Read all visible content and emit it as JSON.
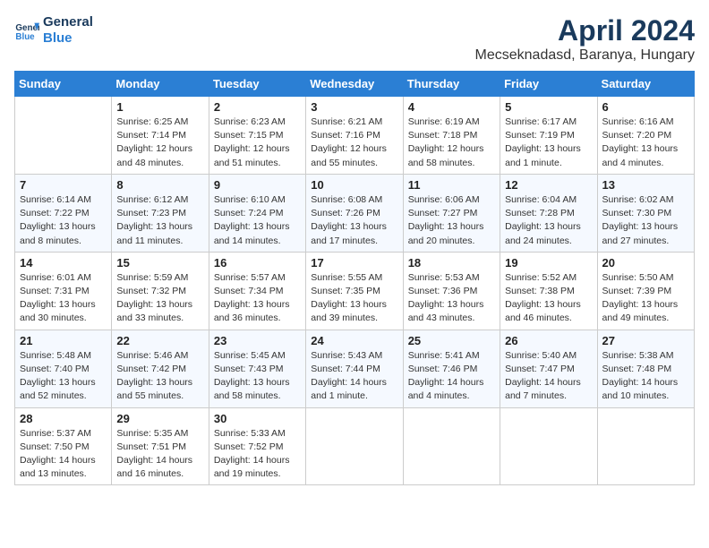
{
  "header": {
    "logo_line1": "General",
    "logo_line2": "Blue",
    "month": "April 2024",
    "location": "Mecseknadasd, Baranya, Hungary"
  },
  "days_of_week": [
    "Sunday",
    "Monday",
    "Tuesday",
    "Wednesday",
    "Thursday",
    "Friday",
    "Saturday"
  ],
  "weeks": [
    [
      {
        "day": "",
        "info": ""
      },
      {
        "day": "1",
        "info": "Sunrise: 6:25 AM\nSunset: 7:14 PM\nDaylight: 12 hours\nand 48 minutes."
      },
      {
        "day": "2",
        "info": "Sunrise: 6:23 AM\nSunset: 7:15 PM\nDaylight: 12 hours\nand 51 minutes."
      },
      {
        "day": "3",
        "info": "Sunrise: 6:21 AM\nSunset: 7:16 PM\nDaylight: 12 hours\nand 55 minutes."
      },
      {
        "day": "4",
        "info": "Sunrise: 6:19 AM\nSunset: 7:18 PM\nDaylight: 12 hours\nand 58 minutes."
      },
      {
        "day": "5",
        "info": "Sunrise: 6:17 AM\nSunset: 7:19 PM\nDaylight: 13 hours\nand 1 minute."
      },
      {
        "day": "6",
        "info": "Sunrise: 6:16 AM\nSunset: 7:20 PM\nDaylight: 13 hours\nand 4 minutes."
      }
    ],
    [
      {
        "day": "7",
        "info": "Sunrise: 6:14 AM\nSunset: 7:22 PM\nDaylight: 13 hours\nand 8 minutes."
      },
      {
        "day": "8",
        "info": "Sunrise: 6:12 AM\nSunset: 7:23 PM\nDaylight: 13 hours\nand 11 minutes."
      },
      {
        "day": "9",
        "info": "Sunrise: 6:10 AM\nSunset: 7:24 PM\nDaylight: 13 hours\nand 14 minutes."
      },
      {
        "day": "10",
        "info": "Sunrise: 6:08 AM\nSunset: 7:26 PM\nDaylight: 13 hours\nand 17 minutes."
      },
      {
        "day": "11",
        "info": "Sunrise: 6:06 AM\nSunset: 7:27 PM\nDaylight: 13 hours\nand 20 minutes."
      },
      {
        "day": "12",
        "info": "Sunrise: 6:04 AM\nSunset: 7:28 PM\nDaylight: 13 hours\nand 24 minutes."
      },
      {
        "day": "13",
        "info": "Sunrise: 6:02 AM\nSunset: 7:30 PM\nDaylight: 13 hours\nand 27 minutes."
      }
    ],
    [
      {
        "day": "14",
        "info": "Sunrise: 6:01 AM\nSunset: 7:31 PM\nDaylight: 13 hours\nand 30 minutes."
      },
      {
        "day": "15",
        "info": "Sunrise: 5:59 AM\nSunset: 7:32 PM\nDaylight: 13 hours\nand 33 minutes."
      },
      {
        "day": "16",
        "info": "Sunrise: 5:57 AM\nSunset: 7:34 PM\nDaylight: 13 hours\nand 36 minutes."
      },
      {
        "day": "17",
        "info": "Sunrise: 5:55 AM\nSunset: 7:35 PM\nDaylight: 13 hours\nand 39 minutes."
      },
      {
        "day": "18",
        "info": "Sunrise: 5:53 AM\nSunset: 7:36 PM\nDaylight: 13 hours\nand 43 minutes."
      },
      {
        "day": "19",
        "info": "Sunrise: 5:52 AM\nSunset: 7:38 PM\nDaylight: 13 hours\nand 46 minutes."
      },
      {
        "day": "20",
        "info": "Sunrise: 5:50 AM\nSunset: 7:39 PM\nDaylight: 13 hours\nand 49 minutes."
      }
    ],
    [
      {
        "day": "21",
        "info": "Sunrise: 5:48 AM\nSunset: 7:40 PM\nDaylight: 13 hours\nand 52 minutes."
      },
      {
        "day": "22",
        "info": "Sunrise: 5:46 AM\nSunset: 7:42 PM\nDaylight: 13 hours\nand 55 minutes."
      },
      {
        "day": "23",
        "info": "Sunrise: 5:45 AM\nSunset: 7:43 PM\nDaylight: 13 hours\nand 58 minutes."
      },
      {
        "day": "24",
        "info": "Sunrise: 5:43 AM\nSunset: 7:44 PM\nDaylight: 14 hours\nand 1 minute."
      },
      {
        "day": "25",
        "info": "Sunrise: 5:41 AM\nSunset: 7:46 PM\nDaylight: 14 hours\nand 4 minutes."
      },
      {
        "day": "26",
        "info": "Sunrise: 5:40 AM\nSunset: 7:47 PM\nDaylight: 14 hours\nand 7 minutes."
      },
      {
        "day": "27",
        "info": "Sunrise: 5:38 AM\nSunset: 7:48 PM\nDaylight: 14 hours\nand 10 minutes."
      }
    ],
    [
      {
        "day": "28",
        "info": "Sunrise: 5:37 AM\nSunset: 7:50 PM\nDaylight: 14 hours\nand 13 minutes."
      },
      {
        "day": "29",
        "info": "Sunrise: 5:35 AM\nSunset: 7:51 PM\nDaylight: 14 hours\nand 16 minutes."
      },
      {
        "day": "30",
        "info": "Sunrise: 5:33 AM\nSunset: 7:52 PM\nDaylight: 14 hours\nand 19 minutes."
      },
      {
        "day": "",
        "info": ""
      },
      {
        "day": "",
        "info": ""
      },
      {
        "day": "",
        "info": ""
      },
      {
        "day": "",
        "info": ""
      }
    ]
  ]
}
